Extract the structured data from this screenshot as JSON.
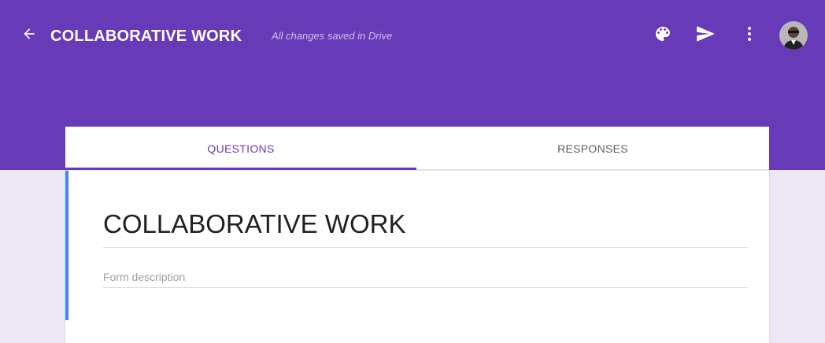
{
  "header": {
    "title": "COLLABORATIVE WORK",
    "save_status": "All changes saved in Drive",
    "icons": [
      "arrow-back-icon",
      "palette-icon",
      "send-icon",
      "more-vert-icon",
      "avatar"
    ],
    "background_color": "#673ab7"
  },
  "tabs": {
    "questions": "QUESTIONS",
    "responses": "RESPONSES",
    "active": "QUESTIONS"
  },
  "form": {
    "title": "COLLABORATIVE WORK",
    "description_placeholder": "Form description"
  },
  "colors": {
    "accent": "#673ab7",
    "page_background": "#ede7f6",
    "focus_indicator": "#4285f4"
  }
}
